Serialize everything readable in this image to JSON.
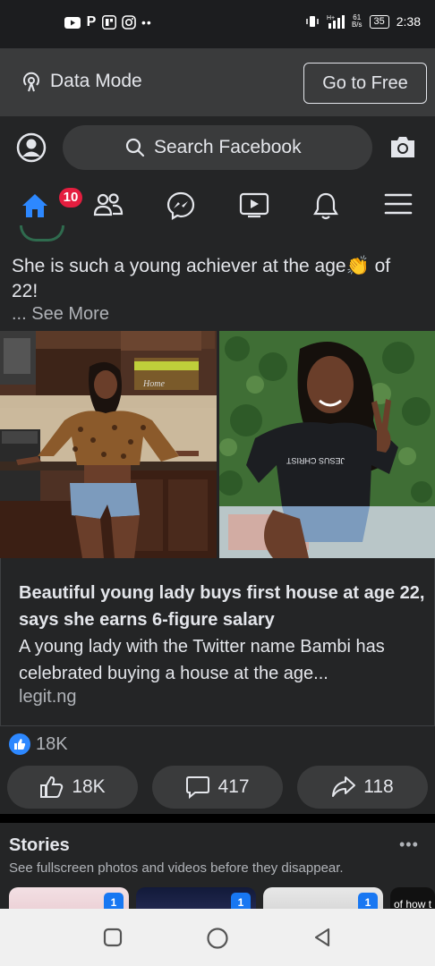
{
  "status_bar": {
    "time": "2:38",
    "battery": "35",
    "net_speed_value": "61",
    "net_speed_unit": "B/s",
    "network_type": "H+"
  },
  "data_mode": {
    "label": "Data Mode",
    "go_free_label": "Go to Free"
  },
  "header": {
    "search_placeholder": "Search Facebook",
    "notification_badge": "10"
  },
  "nav_icons": [
    "home-icon",
    "friends-icon",
    "messenger-icon",
    "watch-icon",
    "notifications-icon",
    "menu-icon"
  ],
  "post": {
    "text_line1": "She is such a young achiever at the age👏 of",
    "text_line2": "22!",
    "see_more": "... See More",
    "link": {
      "title": "Beautiful young lady buys first house at age 22, says she earns 6-figure salary",
      "description": "A young lady with the Twitter name Bambi has celebrated buying a house at the age...",
      "domain": "legit.ng"
    },
    "reaction_count": "18K",
    "actions": {
      "like": "18K",
      "comment": "417",
      "share": "118"
    },
    "kitchen_sign": "Home",
    "shirt_text": "JESUS CHRIST"
  },
  "stories": {
    "title": "Stories",
    "subtitle": "See fullscreen photos and videos before they disappear.",
    "items": [
      {
        "count": "1"
      },
      {
        "count": "1"
      },
      {
        "count": "1"
      },
      {
        "text": "of how t"
      }
    ]
  },
  "colors": {
    "background": "#18191a",
    "surface": "#242526",
    "accent": "#1877f2",
    "badge": "#e41e3f"
  }
}
